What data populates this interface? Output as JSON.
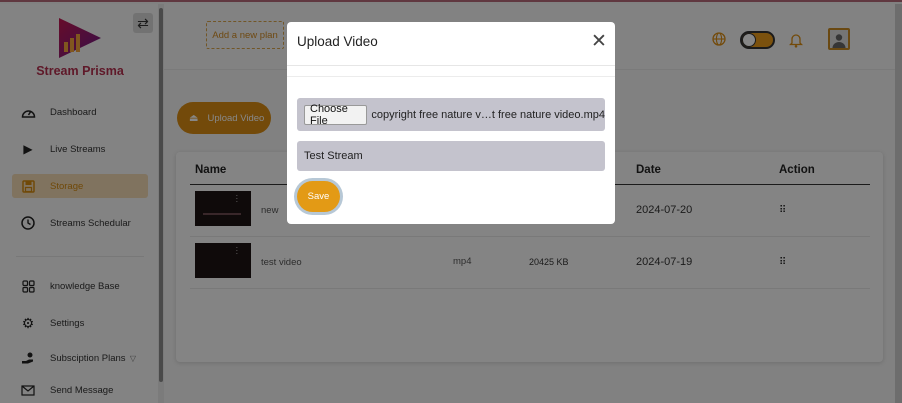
{
  "brand": {
    "name": "Stream Prisma"
  },
  "sidebar": {
    "items": [
      {
        "label": "Dashboard",
        "icon": "gauge-icon"
      },
      {
        "label": "Live Streams",
        "icon": "play-icon"
      },
      {
        "label": "Storage",
        "icon": "save-icon",
        "active": true
      },
      {
        "label": "Streams Schedular",
        "icon": "clock-icon"
      },
      {
        "label": "knowledge Base",
        "icon": "grid-icon"
      },
      {
        "label": "Settings",
        "icon": "gear-icon"
      },
      {
        "label": "Subsciption Plans",
        "icon": "hand-coin-icon"
      },
      {
        "label": "Send Message",
        "icon": "envelope-icon"
      }
    ]
  },
  "header": {
    "add_plan": "Add a new plan"
  },
  "main": {
    "upload_button": "Upload Video",
    "table": {
      "headers": [
        "Name",
        "Date",
        "Action"
      ],
      "rows": [
        {
          "name": "new",
          "type": "",
          "size": "",
          "date": "2024-07-20"
        },
        {
          "name": "test video",
          "type": "mp4",
          "size": "20425 KB",
          "date": "2024-07-19"
        }
      ]
    }
  },
  "modal": {
    "title": "Upload Video",
    "file_button": "Choose File",
    "file_name": "copyright free nature v…t free nature video.mp4",
    "name_value": "Test Stream",
    "save_label": "Save"
  },
  "colors": {
    "accent": "#d98d13",
    "brand": "#b3304f"
  }
}
